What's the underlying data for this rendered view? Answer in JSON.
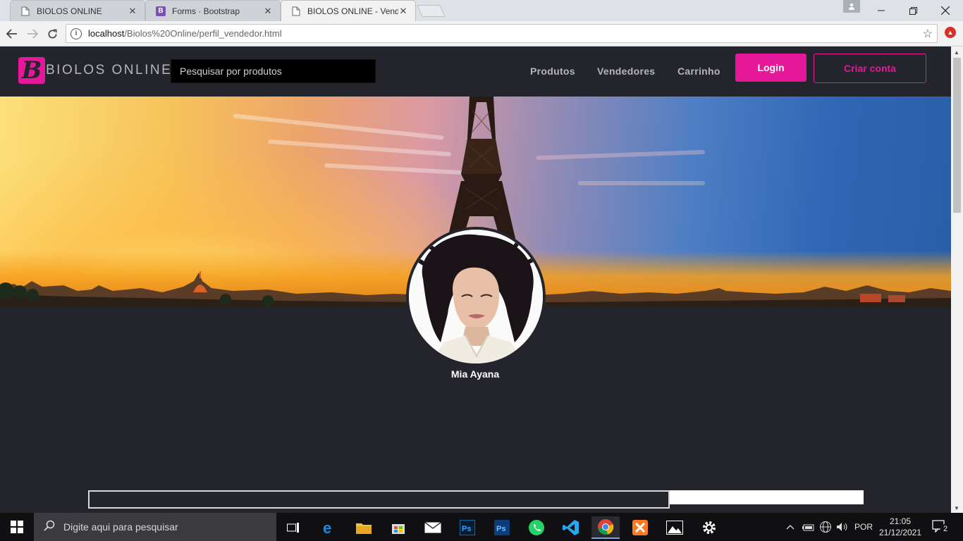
{
  "browser": {
    "tabs": [
      {
        "title": "BIOLOS ONLINE",
        "icon": "page-icon"
      },
      {
        "title": "Forms · Bootstrap",
        "icon": "bootstrap-icon"
      },
      {
        "title": "BIOLOS ONLINE - Vende",
        "icon": "page-icon"
      }
    ],
    "close_glyph": "✕",
    "favicon_b": "B",
    "url_host": "localhost",
    "url_path": "/Biolos%20Online/perfil_vendedor.html"
  },
  "site": {
    "logo_letter": "B",
    "logo_text": "BIOLOS ONLINE",
    "search_placeholder": "Pesquisar por produtos",
    "nav": [
      "Produtos",
      "Vendedores",
      "Carrinho"
    ],
    "login_label": "Login",
    "signup_label": "Criar conta",
    "brand_color": "#e5189a",
    "bg_color": "#24242c"
  },
  "profile": {
    "name": "Mia Ayana"
  },
  "taskbar": {
    "search_placeholder": "Digite aqui para pesquisar",
    "language": "POR",
    "time": "21:05",
    "date": "21/12/2021",
    "notifications": "2",
    "apps": [
      "task-view-icon",
      "edge-icon",
      "file-explorer-icon",
      "store-icon",
      "mail-icon",
      "photoshop-icon",
      "photoshop-icon",
      "whatsapp-icon",
      "vscode-icon",
      "chrome-icon",
      "xampp-icon",
      "photos-icon",
      "settings-icon"
    ]
  }
}
